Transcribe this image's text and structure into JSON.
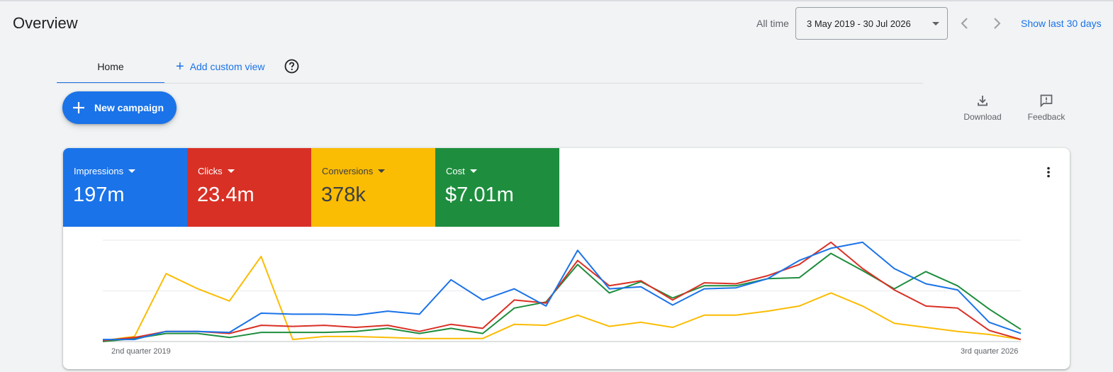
{
  "header": {
    "title": "Overview",
    "date_range_label": "All time",
    "date_range_value": "3 May 2019 - 30 Jul 2026",
    "show_last_link": "Show last 30 days"
  },
  "tabs": {
    "home_label": "Home",
    "add_custom_view_label": "Add custom view"
  },
  "actions": {
    "new_campaign_label": "New campaign",
    "download_label": "Download",
    "feedback_label": "Feedback"
  },
  "metrics": [
    {
      "label": "Impressions",
      "value": "197m",
      "bg_color": "#1a73e8",
      "text_color": "#ffffff"
    },
    {
      "label": "Clicks",
      "value": "23.4m",
      "bg_color": "#d93025",
      "text_color": "#ffffff"
    },
    {
      "label": "Conversions",
      "value": "378k",
      "bg_color": "#fbbc04",
      "text_color": "#3c4043"
    },
    {
      "label": "Cost",
      "value": "$7.01m",
      "bg_color": "#1e8e3e",
      "text_color": "#ffffff"
    }
  ],
  "icons": {
    "date_dropdown": "caret-down-icon",
    "prev": "chevron-left-icon",
    "next": "chevron-right-icon",
    "help": "help-circle-icon",
    "add": "plus-icon",
    "download": "download-icon",
    "feedback": "feedback-icon",
    "more": "more-vert-icon"
  },
  "chart_data": {
    "type": "line",
    "title": "",
    "xlabel": "",
    "ylabel": "",
    "grid": true,
    "legend": "none",
    "y_scale": "normalized per metric (no axis values shown)",
    "ylim": [
      0,
      100
    ],
    "x_tick_labels": [
      "2nd quarter 2019",
      "3rd quarter 2026"
    ],
    "x": [
      "Q2 2019",
      "Q3 2019",
      "Q4 2019",
      "Q1 2020",
      "Q2 2020",
      "Q3 2020",
      "Q4 2020",
      "Q1 2021",
      "Q2 2021",
      "Q3 2021",
      "Q4 2021",
      "Q1 2022",
      "Q2 2022",
      "Q3 2022",
      "Q4 2022",
      "Q1 2023",
      "Q2 2023",
      "Q3 2023",
      "Q4 2023",
      "Q1 2024",
      "Q2 2024",
      "Q3 2024",
      "Q4 2024",
      "Q1 2025",
      "Q2 2025",
      "Q3 2025",
      "Q4 2025",
      "Q1 2026",
      "Q2 2026",
      "Q3 2026"
    ],
    "series": [
      {
        "metric": "Impressions",
        "color": "#1a73e8",
        "values": [
          2,
          2,
          10,
          10,
          9,
          28,
          27,
          27,
          26,
          30,
          27,
          61,
          41,
          52,
          35,
          90,
          52,
          54,
          36,
          52,
          53,
          62,
          80,
          92,
          98,
          72,
          57,
          51,
          19,
          8
        ]
      },
      {
        "metric": "Clicks",
        "color": "#d93025",
        "values": [
          1,
          4,
          10,
          10,
          8,
          16,
          15,
          16,
          14,
          16,
          10,
          17,
          13,
          41,
          38,
          80,
          55,
          60,
          41,
          58,
          57,
          65,
          76,
          98,
          72,
          51,
          35,
          33,
          11,
          2
        ]
      },
      {
        "metric": "Conversions",
        "color": "#fbbc04",
        "values": [
          1,
          5,
          67,
          52,
          40,
          84,
          2,
          5,
          5,
          4,
          3,
          3,
          3,
          17,
          16,
          26,
          15,
          19,
          14,
          26,
          26,
          30,
          35,
          48,
          35,
          18,
          14,
          10,
          7,
          2
        ]
      },
      {
        "metric": "Cost",
        "color": "#1e8e3e",
        "values": [
          0,
          3,
          8,
          8,
          4,
          9,
          9,
          9,
          10,
          13,
          8,
          13,
          8,
          33,
          39,
          76,
          48,
          59,
          43,
          55,
          55,
          62,
          63,
          87,
          70,
          52,
          69,
          55,
          32,
          12
        ]
      }
    ]
  }
}
